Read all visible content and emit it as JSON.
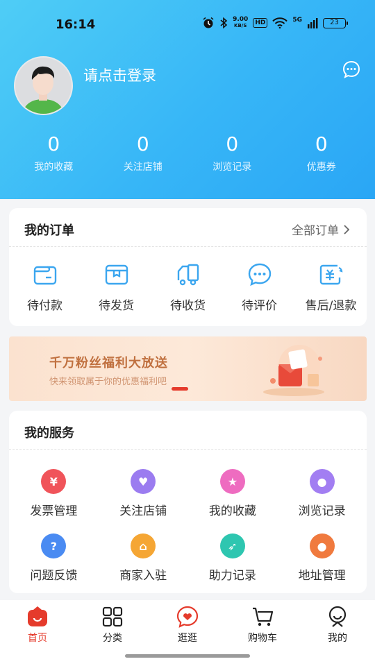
{
  "status_bar": {
    "time": "16:14",
    "speed_value": "9.00",
    "speed_unit": "KB/S",
    "hd": "HD",
    "network": "5G",
    "battery": "23"
  },
  "profile": {
    "login_prompt": "请点击登录"
  },
  "stats": [
    {
      "value": "0",
      "label": "我的收藏"
    },
    {
      "value": "0",
      "label": "关注店铺"
    },
    {
      "value": "0",
      "label": "浏览记录"
    },
    {
      "value": "0",
      "label": "优惠券"
    }
  ],
  "orders": {
    "title": "我的订单",
    "all_orders": "全部订单",
    "items": [
      {
        "label": "待付款",
        "icon": "wallet-icon"
      },
      {
        "label": "待发货",
        "icon": "package-icon"
      },
      {
        "label": "待收货",
        "icon": "truck-icon"
      },
      {
        "label": "待评价",
        "icon": "chat-icon"
      },
      {
        "label": "售后/退款",
        "icon": "refund-icon"
      }
    ]
  },
  "banner": {
    "title": "千万粉丝福利大放送",
    "subtitle": "快来领取属于你的优惠福利吧"
  },
  "services": {
    "title": "我的服务",
    "items": [
      {
        "label": "发票管理",
        "icon": "invoice-icon",
        "color": "#f0545a",
        "glyph": "¥"
      },
      {
        "label": "关注店铺",
        "icon": "heart-icon",
        "color": "#9b7cf0",
        "glyph": "♥"
      },
      {
        "label": "我的收藏",
        "icon": "star-icon",
        "color": "#ee6cc0",
        "glyph": "★"
      },
      {
        "label": "浏览记录",
        "icon": "footprint-icon",
        "color": "#a27ef2",
        "glyph": "●"
      },
      {
        "label": "问题反馈",
        "icon": "question-icon",
        "color": "#4a8bf2",
        "glyph": "?"
      },
      {
        "label": "商家入驻",
        "icon": "shop-icon",
        "color": "#f5a634",
        "glyph": "⌂"
      },
      {
        "label": "助力记录",
        "icon": "rocket-icon",
        "color": "#2ec6b0",
        "glyph": "➶"
      },
      {
        "label": "地址管理",
        "icon": "location-icon",
        "color": "#f07a3e",
        "glyph": "●"
      }
    ]
  },
  "tabbar": [
    {
      "label": "首页",
      "icon": "home-icon",
      "active": true
    },
    {
      "label": "分类",
      "icon": "grid-icon",
      "active": false
    },
    {
      "label": "逛逛",
      "icon": "explore-icon",
      "active": false
    },
    {
      "label": "购物车",
      "icon": "cart-icon",
      "active": false
    },
    {
      "label": "我的",
      "icon": "profile-icon",
      "active": false
    }
  ],
  "colors": {
    "header_gradient_start": "#4fcdf6",
    "header_gradient_end": "#2aa6f5",
    "accent_red": "#e53b2c",
    "order_icon_blue": "#3ba6ef"
  }
}
